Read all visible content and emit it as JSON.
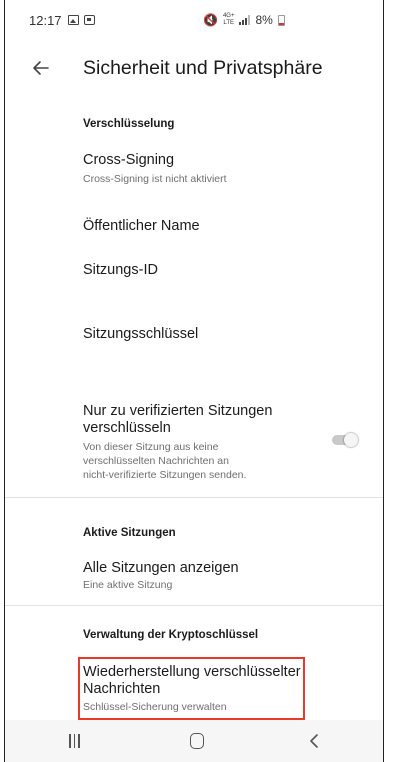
{
  "status_bar": {
    "time": "12:17",
    "battery": "8%",
    "network_top": "4G+",
    "network_bottom": "LTE"
  },
  "app_bar": {
    "title": "Sicherheit und Privatsphäre",
    "back_icon": "arrow-left-icon"
  },
  "sections": {
    "encryption": {
      "header": "Verschlüsselung",
      "cross_signing": {
        "title": "Cross-Signing",
        "subtitle": "Cross-Signing ist nicht aktiviert"
      },
      "public_name": {
        "title": "Öffentlicher Name"
      },
      "session_id": {
        "title": "Sitzungs-ID"
      },
      "session_key": {
        "title": "Sitzungsschlüssel"
      },
      "verified_only": {
        "title_line1": "Nur zu verifizierten Sitzungen",
        "title_line2": "verschlüsseln",
        "subtitle_line1": "Von dieser Sitzung aus keine",
        "subtitle_line2": "verschlüsselten Nachrichten an",
        "subtitle_line3": "nicht-verifizierte Sitzungen senden.",
        "toggle_on": false
      }
    },
    "active_sessions": {
      "header": "Aktive Sitzungen",
      "show_all": {
        "title": "Alle Sitzungen anzeigen",
        "subtitle": "Eine aktive Sitzung"
      }
    },
    "crypto_keys": {
      "header": "Verwaltung der Kryptoschlüssel",
      "recovery": {
        "title_line1": "Wiederherstellung verschlüsselter",
        "title_line2": "Nachrichten",
        "subtitle": "Schlüssel-Sicherung verwalten"
      }
    }
  },
  "colors": {
    "highlight": "#e8392b",
    "divider": "#e2e2e2",
    "subtitle": "#6f6f6f"
  },
  "nav_bar": {
    "recent_icon": "recent-apps-icon",
    "home_icon": "home-icon",
    "back_icon": "back-chevron-icon"
  }
}
